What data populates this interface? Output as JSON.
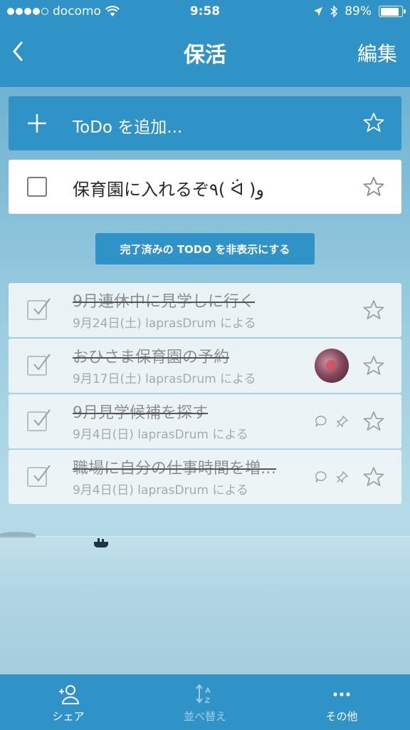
{
  "status_bar": {
    "carrier": "docomo",
    "time": "9:58",
    "battery": "89%",
    "battery_level": 0.89
  },
  "nav": {
    "title": "保活",
    "edit_label": "編集"
  },
  "add_todo": {
    "placeholder": "ToDo を追加..."
  },
  "active_tasks": [
    {
      "title": "保育園に入れるぞ٩( ᐛ )و",
      "completed": false
    }
  ],
  "toggle_completed_label": "完了済みの TODO を非表示にする",
  "completed_tasks": [
    {
      "title": "9月連休中に見学しに行く",
      "meta": "9月24日(土) laprasDrum による"
    },
    {
      "title": "おひさま保育園の予約",
      "meta": "9月17日(土) laprasDrum による"
    },
    {
      "title": "9月見学候補を探す",
      "meta": "9月4日(日) laprasDrum による"
    },
    {
      "title": "職場に自分の仕事時間を増…",
      "meta": "9月4日(日) laprasDrum による"
    }
  ],
  "tabbar": {
    "share": "シェア",
    "sort": "並べ替え",
    "more": "その他"
  },
  "colors": {
    "accent": "#2f93c7"
  }
}
